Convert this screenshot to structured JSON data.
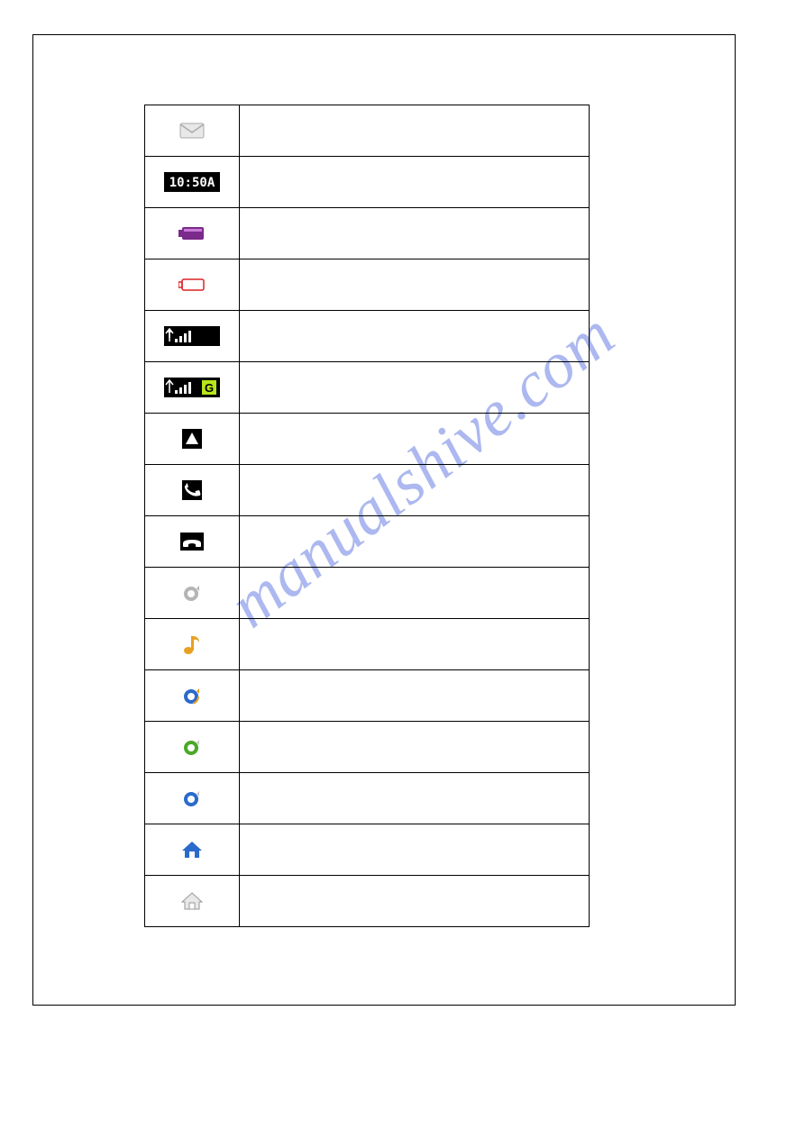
{
  "watermark": "manualshive.com",
  "table": {
    "rows": [
      {
        "icon": "envelope-icon",
        "desc": ""
      },
      {
        "icon": "clock-icon",
        "desc": ""
      },
      {
        "icon": "battery-full-icon",
        "desc": ""
      },
      {
        "icon": "battery-low-icon",
        "desc": ""
      },
      {
        "icon": "signal-icon",
        "desc": ""
      },
      {
        "icon": "signal-g-icon",
        "desc": ""
      },
      {
        "icon": "roaming-icon",
        "desc": ""
      },
      {
        "icon": "call-active-icon",
        "desc": ""
      },
      {
        "icon": "call-end-icon",
        "desc": ""
      },
      {
        "icon": "ring-normal-icon",
        "desc": ""
      },
      {
        "icon": "music-note-icon",
        "desc": ""
      },
      {
        "icon": "ring-orange-icon",
        "desc": ""
      },
      {
        "icon": "ring-green-icon",
        "desc": ""
      },
      {
        "icon": "ring-blue-icon",
        "desc": ""
      },
      {
        "icon": "home-blue-icon",
        "desc": ""
      },
      {
        "icon": "home-outline-icon",
        "desc": ""
      }
    ]
  },
  "clock_text": "10:50A",
  "g_text": "G"
}
